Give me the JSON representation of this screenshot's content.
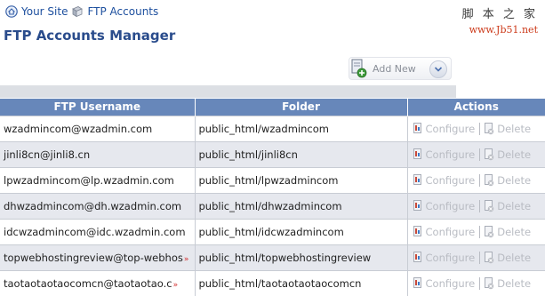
{
  "breadcrumb": {
    "home": "Your Site",
    "current": "FTP Accounts"
  },
  "watermark": {
    "line1": "脚 本 之 家",
    "line2": "www.Jb51.net"
  },
  "page": {
    "title": "FTP Accounts Manager"
  },
  "toolbar": {
    "add_new_label": "Add New"
  },
  "table": {
    "headers": {
      "username": "FTP Username",
      "folder": "Folder",
      "actions": "Actions"
    },
    "action_labels": {
      "configure": "Configure",
      "delete": "Delete"
    },
    "rows": [
      {
        "username": "wzadmincom@wzadmin.com",
        "folder": "public_html/wzadmincom"
      },
      {
        "username": "jinli8cn@jinli8.cn",
        "folder": "public_html/jinli8cn"
      },
      {
        "username": "lpwzadmincom@lp.wzadmin.com",
        "folder": "public_html/lpwzadmincom"
      },
      {
        "username": "dhwzadmincom@dh.wzadmin.com",
        "folder": "public_html/dhwzadmincom"
      },
      {
        "username": "idcwzadmincom@idc.wzadmin.com",
        "folder": "public_html/idcwzadmincom"
      },
      {
        "username": "topwebhostingreview@top-webhos",
        "folder": "public_html/topwebhostingreview",
        "truncated": "»"
      },
      {
        "username": "taotaotaotaocomcn@taotaotao.c",
        "folder": "public_html/taotaotaotaocomcn",
        "truncated": "»"
      }
    ]
  },
  "colors": {
    "header_bg": "#6787ba",
    "title": "#2a4c8c",
    "link": "#1d4f9e",
    "disabled_action": "#b9bcc3"
  },
  "icons": {
    "home": "home-icon",
    "ftp": "ftp-folder-icon",
    "add": "add-document-icon",
    "dropdown": "chevron-down-icon",
    "configure": "configure-icon",
    "delete": "delete-icon"
  }
}
